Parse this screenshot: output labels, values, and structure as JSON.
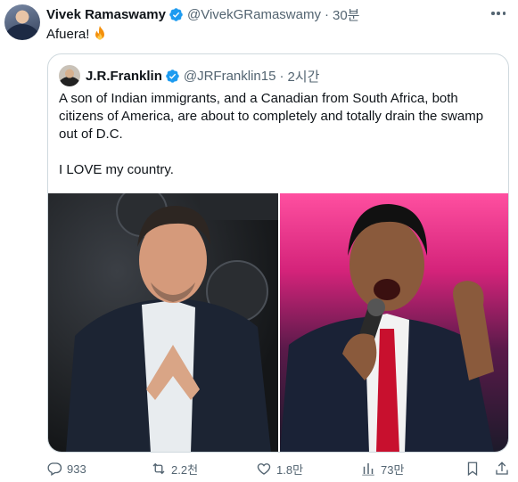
{
  "tweet": {
    "author_name": "Vivek Ramaswamy",
    "handle": "@VivekGRamaswamy",
    "separator": "·",
    "time": "30분",
    "text": "Afuera!",
    "text_emoji": "fire-icon"
  },
  "quoted": {
    "author_name": "J.R.Franklin",
    "handle": "@JRFranklin15",
    "separator": "·",
    "time": "2시간",
    "paragraphs": [
      "A son of Indian immigrants, and a Canadian from South Africa, both citizens of America, are about to completely and totally drain the swamp out of D.C.",
      "I LOVE my country."
    ],
    "images": [
      "photo of man with steepled hands",
      "photo of man speaking into microphone"
    ]
  },
  "actions": {
    "replies": "933",
    "reposts": "2.2천",
    "likes": "1.8만",
    "views": "73만"
  },
  "colors": {
    "verified": "#1d9bf0",
    "text": "#0f1419",
    "muted": "#536471",
    "border": "#cfd9de"
  }
}
